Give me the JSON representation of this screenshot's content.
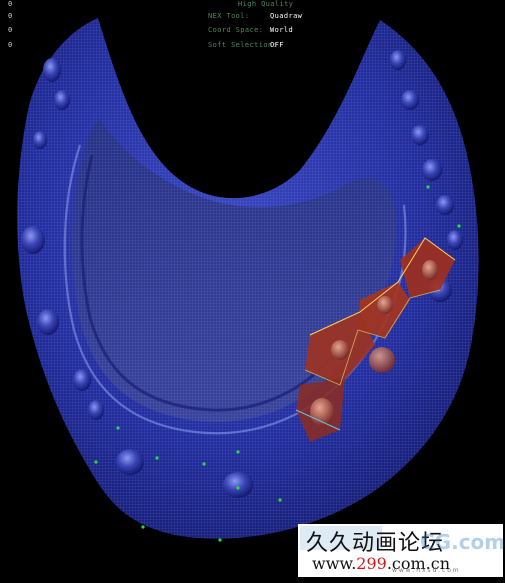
{
  "hud": {
    "quality": "High Quality",
    "counters": [
      "0",
      "0",
      "0",
      "0"
    ],
    "rows": [
      {
        "label": "NEX Tool:",
        "value": "Quadraw"
      },
      {
        "label": "Coord Space:",
        "value": "World"
      },
      {
        "label": "Soft Selection:",
        "value": "OFF"
      }
    ]
  },
  "watermark": {
    "title": "久久动画论坛",
    "url_prefix": "www.",
    "url_number": "299",
    "url_suffix": ".com.cn",
    "logo_text": "CG.com",
    "sub_text": "w w w . h x s d . c o m"
  },
  "colors": {
    "mesh": "#1f2a9a",
    "wire": "#6a7be0",
    "selected_faces": "#b03818",
    "vertex": "#22dd44",
    "hud_label": "#4e8a58"
  }
}
